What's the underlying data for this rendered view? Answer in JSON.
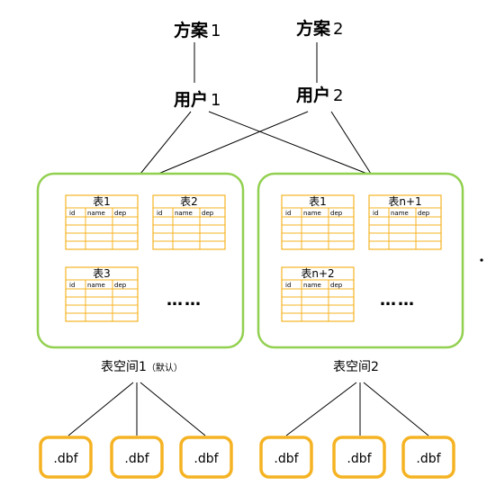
{
  "schemes": [
    {
      "label": "方案",
      "num": "1"
    },
    {
      "label": "方案",
      "num": "2"
    }
  ],
  "users": [
    {
      "label": "用户",
      "num": "1"
    },
    {
      "label": "用户",
      "num": "2"
    }
  ],
  "tablespaces": [
    {
      "name": "表空间1",
      "note": "（默认）",
      "tables": [
        {
          "title": "表1",
          "columns": [
            "id",
            "name",
            "dep"
          ]
        },
        {
          "title": "表2",
          "columns": [
            "id",
            "name",
            "dep"
          ]
        },
        {
          "title": "表3",
          "columns": [
            "id",
            "name",
            "dep"
          ]
        }
      ],
      "ellipsis": "……",
      "files": [
        ".dbf",
        ".dbf",
        ".dbf"
      ]
    },
    {
      "name": "表空间2",
      "note": "",
      "tables": [
        {
          "title": "表1",
          "columns": [
            "id",
            "name",
            "dep"
          ]
        },
        {
          "title": "表n+1",
          "columns": [
            "id",
            "name",
            "dep"
          ]
        },
        {
          "title": "表n+2",
          "columns": [
            "id",
            "name",
            "dep"
          ]
        }
      ],
      "ellipsis": "……",
      "files": [
        ".dbf",
        ".dbf",
        ".dbf"
      ]
    }
  ],
  "colors": {
    "tablespace_border": "#92d050",
    "table_border": "#f5b323",
    "table_grid": "#f5b323",
    "file_border": "#f5b323",
    "line": "#000000"
  }
}
